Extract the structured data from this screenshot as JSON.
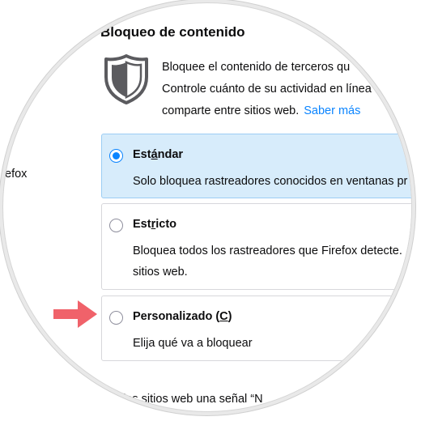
{
  "section": {
    "title": "Bloqueo de contenido"
  },
  "description": {
    "line1": "Bloquee el contenido de terceros qu",
    "line2": "Controle cuánto de su actividad en línea",
    "line3": "comparte entre sitios web.",
    "learn_more": "Saber más"
  },
  "left_fragment": "efox",
  "options": [
    {
      "title_before": "Est",
      "title_access": "á",
      "title_after": "ndar",
      "desc1": "Solo bloquea rastreadores conocidos en ventanas pr",
      "checked": true
    },
    {
      "title_before": "Est",
      "title_access": "r",
      "title_after": "icto",
      "desc1": "Bloquea todos los rastreadores que Firefox detecte.",
      "desc2": "sitios web.",
      "checked": false
    },
    {
      "title_before": "Personalizado (",
      "title_access": "C",
      "title_after": ")",
      "desc1": "Elija qué va a bloquear",
      "checked": false
    }
  ],
  "bottom_fragment": "a los sitios web una señal “N",
  "colors": {
    "accent": "#0a84ff",
    "selected_bg": "#d7ecfb",
    "arrow": "#f0626a",
    "shield": "#5b5b5f"
  }
}
